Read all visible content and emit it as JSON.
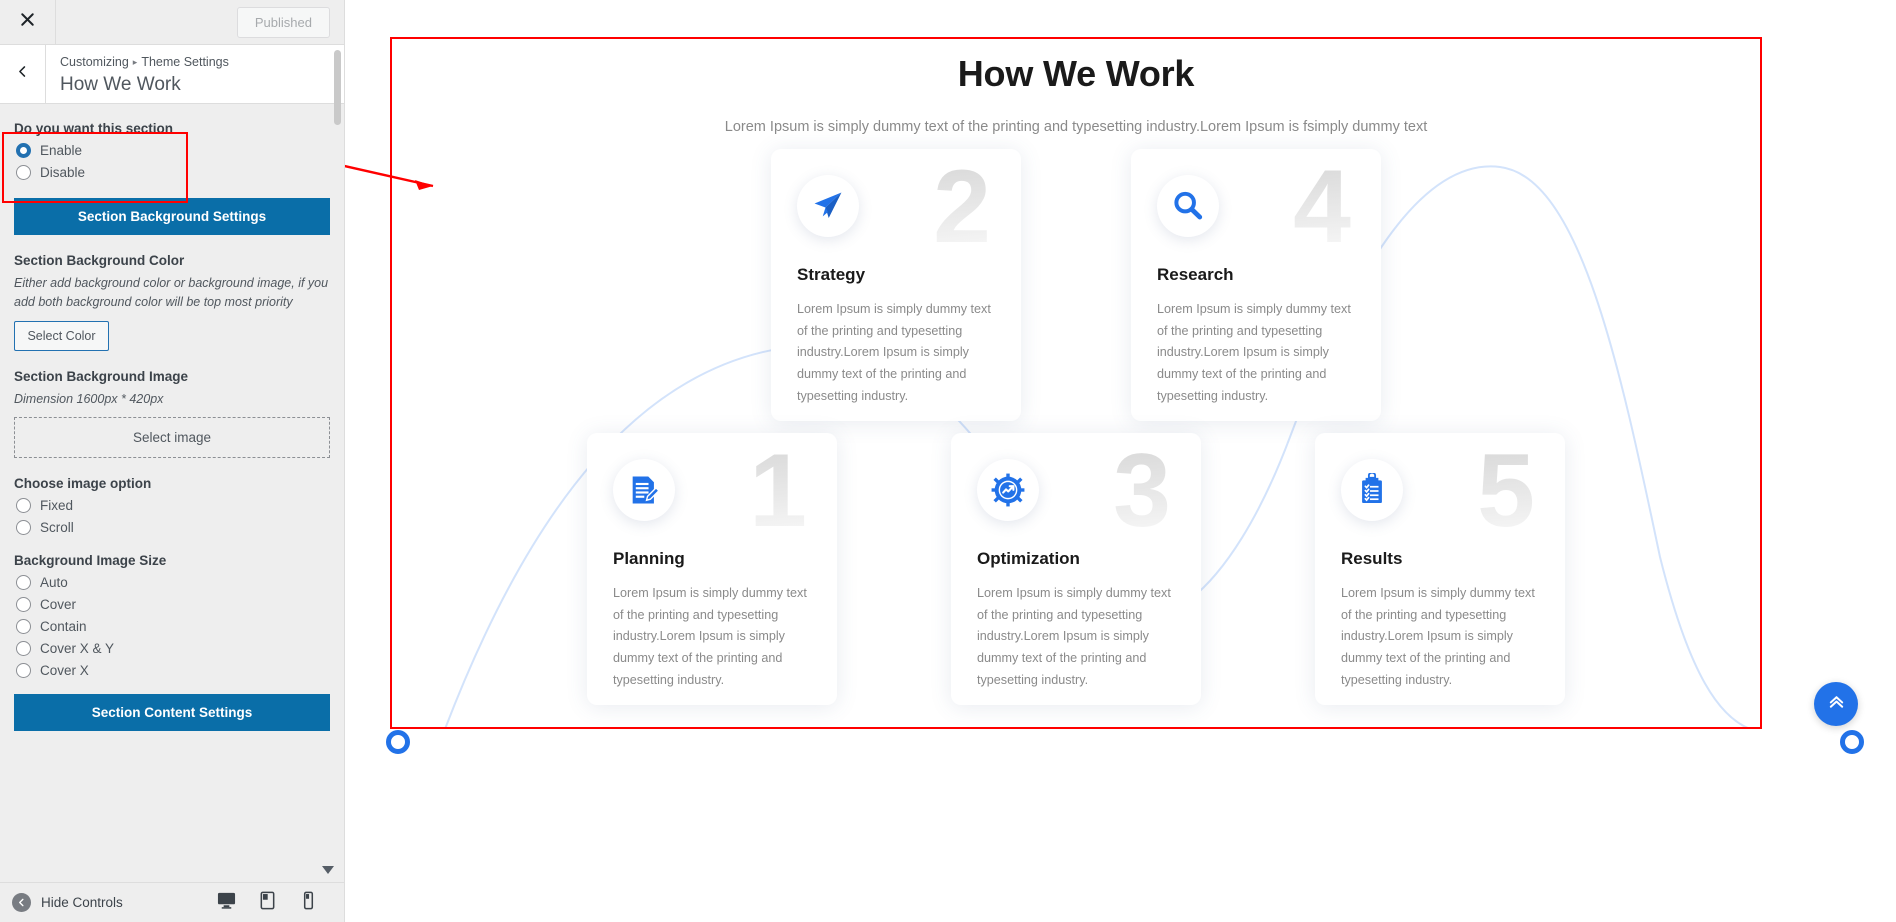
{
  "customizer": {
    "close_icon": "close-icon",
    "publish_button": "Published",
    "back_icon": "chevron-left-icon",
    "breadcrumb_root": "Customizing",
    "breadcrumb_sep": "▸",
    "breadcrumb_parent": "Theme Settings",
    "panel_title": "How We Work",
    "footer": {
      "hide_controls_label": "Hide Controls",
      "devices": [
        "desktop-icon",
        "tablet-icon",
        "mobile-icon"
      ]
    },
    "controls": {
      "section_toggle_label": "Do you want this section",
      "section_toggle_options": [
        {
          "label": "Enable",
          "checked": true
        },
        {
          "label": "Disable",
          "checked": false
        }
      ],
      "bg_settings_button": "Section Background Settings",
      "bg_color_label": "Section Background Color",
      "bg_color_help": "Either add background color or background image, if you add both background color will be top most priority",
      "select_color_button": "Select Color",
      "bg_image_label": "Section Background Image",
      "bg_image_dimension": "Dimension 1600px * 420px",
      "select_image_button": "Select image",
      "image_option_label": "Choose image option",
      "image_options": [
        {
          "label": "Fixed",
          "checked": false
        },
        {
          "label": "Scroll",
          "checked": false
        }
      ],
      "image_size_label": "Background Image Size",
      "image_sizes": [
        {
          "label": "Auto",
          "checked": false
        },
        {
          "label": "Cover",
          "checked": false
        },
        {
          "label": "Contain",
          "checked": false
        },
        {
          "label": "Cover X & Y",
          "checked": false
        },
        {
          "label": "Cover X",
          "checked": false
        }
      ],
      "content_settings_button": "Section Content Settings"
    }
  },
  "preview": {
    "title": "How We Work",
    "subtitle": "Lorem Ipsum is simply dummy text of the printing and typesetting industry.Lorem Ipsum is fsimply dummy text",
    "body_text": "Lorem Ipsum is simply dummy text of the printing and typesetting industry.Lorem Ipsum is simply dummy text of the printing and typesetting industry.",
    "cards_top": [
      {
        "number": "2",
        "title": "Strategy",
        "icon": "paper-plane-icon",
        "text": "Lorem Ipsum is simply dummy text of the printing and typesetting industry.Lorem Ipsum is simply dummy text of the printing and typesetting industry."
      },
      {
        "number": "4",
        "title": "Research",
        "icon": "magnifier-icon",
        "text": "Lorem Ipsum is simply dummy text of the printing and typesetting industry.Lorem Ipsum is simply dummy text of the printing and typesetting industry."
      }
    ],
    "cards_bottom": [
      {
        "number": "1",
        "title": "Planning",
        "icon": "document-edit-icon",
        "text": "Lorem Ipsum is simply dummy text of the printing and typesetting industry.Lorem Ipsum is simply dummy text of the printing and typesetting industry."
      },
      {
        "number": "3",
        "title": "Optimization",
        "icon": "gear-chart-icon",
        "text": "Lorem Ipsum is simply dummy text of the printing and typesetting industry.Lorem Ipsum is simply dummy text of the printing and typesetting industry."
      },
      {
        "number": "5",
        "title": "Results",
        "icon": "clipboard-check-icon",
        "text": "Lorem Ipsum is simply dummy text of the printing and typesetting industry.Lorem Ipsum is simply dummy text of the printing and typesetting industry."
      }
    ],
    "scroll_top_icon": "double-chevron-up-icon"
  },
  "colors": {
    "accent_blue": "#2272e8",
    "button_blue": "#0a6ea8",
    "highlight_red": "#ff0000",
    "sidebar_bg": "#eeeeee"
  }
}
